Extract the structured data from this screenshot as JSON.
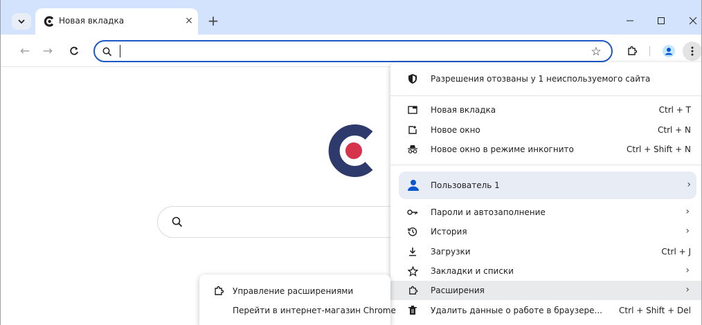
{
  "tab": {
    "title": "Новая вкладка",
    "close_symbol": "×"
  },
  "tabstrip": {
    "new_tab_symbol": "+"
  },
  "window_controls": {
    "minimize": "–",
    "maximize": "☐",
    "close": "×"
  },
  "toolbar": {
    "back": "←",
    "forward": "→",
    "reload": "C"
  },
  "omnibox": {
    "value": "",
    "placeholder": "",
    "bookmark_symbol": "☆"
  },
  "colors": {
    "accent": "#1a57c7",
    "tabstrip": "#d3e3fd",
    "profile_blue": "#0b57d0",
    "logo_navy": "#2d3a6b",
    "logo_red": "#d6344d"
  },
  "menu": {
    "permissions_notice": "Разрешения отозваны у 1 неиспользуемого сайта",
    "new_tab": {
      "label": "Новая вкладка",
      "shortcut": "Ctrl + T"
    },
    "new_window": {
      "label": "Новое окно",
      "shortcut": "Ctrl + N"
    },
    "incognito": {
      "label": "Новое окно в режиме инкогнито",
      "shortcut": "Ctrl + Shift + N"
    },
    "profile": {
      "label": "Пользователь 1"
    },
    "passwords": {
      "label": "Пароли и автозаполнение"
    },
    "history": {
      "label": "История"
    },
    "downloads": {
      "label": "Загрузки",
      "shortcut": "Ctrl + J"
    },
    "bookmarks": {
      "label": "Закладки и списки"
    },
    "extensions": {
      "label": "Расширения"
    },
    "clear_data": {
      "label": "Удалить данные о работе в браузере...",
      "shortcut": "Ctrl + Shift + Del"
    },
    "arrow": "›"
  },
  "extensions_submenu": {
    "manage": "Управление расширениями",
    "webstore": "Перейти в интернет-магазин Chrome"
  }
}
